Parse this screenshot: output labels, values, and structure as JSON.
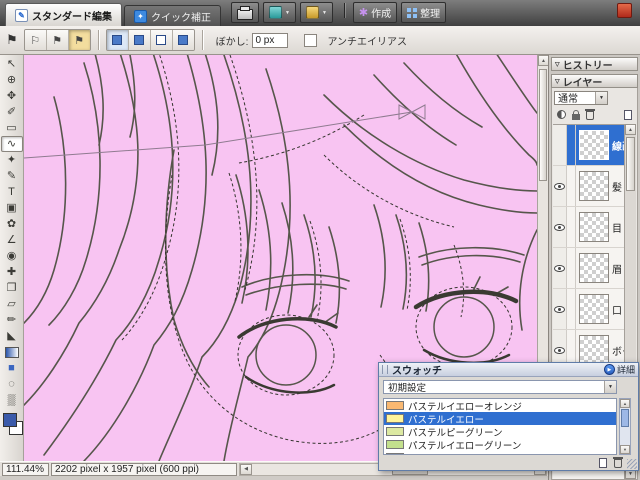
{
  "colors": {
    "selection": "#2f6fd0",
    "canvas_pink": "#f8c4f2"
  },
  "icons": {
    "collapse_triangle": "▽",
    "dropdown_arrow": "▼",
    "detail_play": "▶",
    "scroll_up": "▲",
    "scroll_down": "▼",
    "scroll_left": "◀",
    "scroll_right": "▶",
    "create_star": "✱",
    "standard_edit_pencil": "✎",
    "quick_fix_spark": "✦",
    "flag": "⚑",
    "flag_outline": "⚐"
  },
  "app": {
    "tabs": [
      {
        "label": "スタンダード編集",
        "active": true
      },
      {
        "label": "クイック補正",
        "active": false
      }
    ],
    "create_label": "作成",
    "organize_label": "整理"
  },
  "options_bar": {
    "feather_label": "ぼかし:",
    "feather_value": "0 px",
    "antialias_label": "アンチエイリアス",
    "antialias_checked": false
  },
  "tools": [
    {
      "name": "move",
      "glyph": "↖"
    },
    {
      "name": "zoom",
      "glyph": "⊕"
    },
    {
      "name": "hand",
      "glyph": "✥"
    },
    {
      "name": "eyedropper",
      "glyph": "✐"
    },
    {
      "name": "rect-marquee",
      "glyph": "▭"
    },
    {
      "name": "lasso",
      "glyph": "∿"
    },
    {
      "name": "magic-wand",
      "glyph": "✦"
    },
    {
      "name": "selection-brush",
      "glyph": "✎"
    },
    {
      "name": "type",
      "glyph": "T"
    },
    {
      "name": "crop",
      "glyph": "▣"
    },
    {
      "name": "cookie-cutter",
      "glyph": "✿"
    },
    {
      "name": "straighten",
      "glyph": "∠"
    },
    {
      "name": "red-eye",
      "glyph": "◉"
    },
    {
      "name": "healing-brush",
      "glyph": "✚"
    },
    {
      "name": "clone-stamp",
      "glyph": "❐"
    },
    {
      "name": "eraser",
      "glyph": "▱"
    },
    {
      "name": "brush",
      "glyph": "✏"
    },
    {
      "name": "paint-bucket",
      "glyph": "◣"
    },
    {
      "name": "gradient",
      "glyph": "■"
    },
    {
      "name": "shape",
      "glyph": "■"
    },
    {
      "name": "blur",
      "glyph": "◌"
    },
    {
      "name": "sponge",
      "glyph": "▒"
    }
  ],
  "panels": {
    "history": {
      "title": "ヒストリー"
    },
    "layers": {
      "title": "レイヤー",
      "blend_mode": "通常",
      "items": [
        {
          "name": "線画",
          "selected": true,
          "visible": false
        },
        {
          "name": "髪",
          "selected": false,
          "visible": true
        },
        {
          "name": "目",
          "selected": false,
          "visible": true
        },
        {
          "name": "眉",
          "selected": false,
          "visible": true
        },
        {
          "name": "口 鼻",
          "selected": false,
          "visible": true
        },
        {
          "name": "ボタン",
          "selected": false,
          "visible": true
        }
      ]
    }
  },
  "swatches_panel": {
    "title": "スウォッチ",
    "more_label": "詳細",
    "preset": "初期設定",
    "items": [
      {
        "name": "パステルイエローオレンジ",
        "color": "#F9B871",
        "selected": false
      },
      {
        "name": "パステルイエロー",
        "color": "#FFF49B",
        "selected": true
      },
      {
        "name": "パステルピーグリーン",
        "color": "#DCE9A2",
        "selected": false
      },
      {
        "name": "パステルイエローグリーン",
        "color": "#C3E08D",
        "selected": false
      },
      {
        "name": "",
        "color": "#9CCD72",
        "selected": false
      }
    ]
  },
  "status_bar": {
    "zoom": "111.44%",
    "doc_info": "2202 pixel x 1957 pixel (600 ppi)"
  }
}
